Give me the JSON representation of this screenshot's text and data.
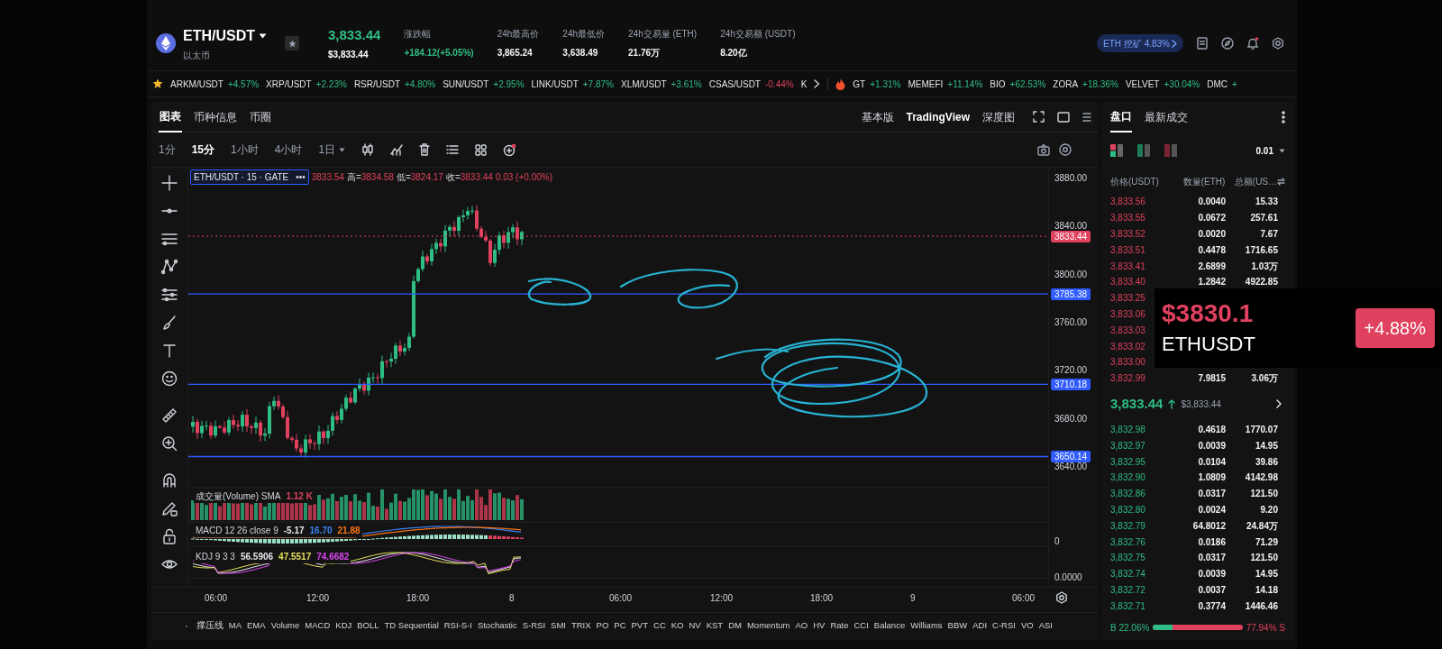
{
  "header": {
    "pair": "ETH/USDT",
    "subtitle": "以太币",
    "price": "3,833.44",
    "price_usd": "$3,833.44",
    "stats": [
      {
        "label": "涨跌幅",
        "value": "+184.12(+5.05%)",
        "kind": "up"
      },
      {
        "label": "24h最高价",
        "value": "3,865.24",
        "kind": "plain"
      },
      {
        "label": "24h最低价",
        "value": "3,638.49",
        "kind": "plain"
      },
      {
        "label": "24h交易量 (ETH)",
        "value": "21.76万",
        "kind": "plain"
      },
      {
        "label": "24h交易额 (USDT)",
        "value": "8.20亿",
        "kind": "plain"
      }
    ],
    "mining_badge": "ETH 挖矿 4.83%"
  },
  "ticker": {
    "favorites": [
      {
        "symbol": "ARKM/USDT",
        "change": "+4.57%",
        "kind": "up"
      },
      {
        "symbol": "XRP/USDT",
        "change": "+2.23%",
        "kind": "up"
      },
      {
        "symbol": "RSR/USDT",
        "change": "+4.80%",
        "kind": "up"
      },
      {
        "symbol": "SUN/USDT",
        "change": "+2.95%",
        "kind": "up"
      },
      {
        "symbol": "LINK/USDT",
        "change": "+7.87%",
        "kind": "up"
      },
      {
        "symbol": "XLM/USDT",
        "change": "+3.61%",
        "kind": "up"
      },
      {
        "symbol": "CSAS/USDT",
        "change": "-0.44%",
        "kind": "down"
      },
      {
        "symbol": "K"
      }
    ],
    "hot": [
      {
        "symbol": "GT",
        "change": "+1.31%",
        "kind": "up"
      },
      {
        "symbol": "MEMEFI",
        "change": "+11.14%",
        "kind": "up"
      },
      {
        "symbol": "BIO",
        "change": "+62.53%",
        "kind": "up"
      },
      {
        "symbol": "ZORA",
        "change": "+18.36%",
        "kind": "up"
      },
      {
        "symbol": "VELVET",
        "change": "+30.04%",
        "kind": "up"
      },
      {
        "symbol": "DMC",
        "change": "+",
        "kind": "up"
      }
    ]
  },
  "chart": {
    "tabs": [
      {
        "label": "图表",
        "selected": true
      },
      {
        "label": "币种信息",
        "selected": false
      },
      {
        "label": "币圈",
        "selected": false
      }
    ],
    "views": [
      {
        "label": "基本版",
        "selected": false
      },
      {
        "label": "TradingView",
        "selected": true
      },
      {
        "label": "深度图",
        "selected": false
      }
    ],
    "intervals": [
      {
        "label": "1分",
        "selected": false
      },
      {
        "label": "15分",
        "selected": true
      },
      {
        "label": "1小时",
        "selected": false
      },
      {
        "label": "4小时",
        "selected": false
      },
      {
        "label": "1日",
        "selected": false,
        "dropdown": true
      }
    ],
    "legend": {
      "symbol": "ETH/USDT · 15 · GATE",
      "more": "•••",
      "items": [
        {
          "value": "3833.54"
        },
        {
          "label": "高=",
          "value": "3834.58"
        },
        {
          "label": "低=",
          "value": "3824.17"
        },
        {
          "label": "收=",
          "value": "3833.44"
        },
        {
          "value": "0.03 (+0.00%)"
        }
      ]
    },
    "price_axis": [
      "3880.00",
      "3840.00",
      "3800.00",
      "3760.00",
      "3720.00",
      "3680.00",
      "3640.00"
    ],
    "price_tags": [
      {
        "value": "3833.44",
        "kind": "last"
      },
      {
        "value": "3785.38",
        "kind": "line"
      },
      {
        "value": "3710.18",
        "kind": "line"
      },
      {
        "value": "3650.14",
        "kind": "line"
      }
    ],
    "indicators": [
      {
        "label": "成交量(Volume) SMA",
        "values": [
          {
            "value": "1.12 K",
            "color": "#e0415e"
          }
        ]
      },
      {
        "label": "MACD 12 26 close 9",
        "values": [
          {
            "value": "-5.17",
            "color": "#e5e7eb"
          },
          {
            "value": "16.70",
            "color": "#3b82f6"
          },
          {
            "value": "21.88",
            "color": "#f97316"
          }
        ]
      },
      {
        "label": "KDJ 9 3 3",
        "values": [
          {
            "value": "56.5906",
            "color": "#e5e7eb"
          },
          {
            "value": "47.5517",
            "color": "#e5e05a"
          },
          {
            "value": "74.6682",
            "color": "#d946ef"
          }
        ]
      }
    ],
    "sub_axis": [
      "0",
      "0.0000"
    ],
    "time_axis": [
      "06:00",
      "12:00",
      "18:00",
      "8",
      "06:00",
      "12:00",
      "18:00",
      "9",
      "06:00"
    ],
    "indicator_bar": [
      "撑压线",
      "MA",
      "EMA",
      "Volume",
      "MACD",
      "KDJ",
      "BOLL",
      "TD Sequential",
      "RSI-S-I",
      "Stochastic",
      "S-RSI",
      "SMI",
      "TRIX",
      "PO",
      "PC",
      "PVT",
      "CC",
      "KO",
      "NV",
      "KST",
      "DM",
      "Momentum",
      "AO",
      "HV",
      "Rate",
      "CCI",
      "Balance",
      "Williams",
      "BBW",
      "ADI",
      "C-RSI",
      "VO",
      "ASI"
    ]
  },
  "order_book": {
    "tabs": [
      {
        "label": "盘口",
        "selected": true
      },
      {
        "label": "最新成交",
        "selected": false
      }
    ],
    "precision": "0.01",
    "columns": [
      "价格(USDT)",
      "数量(ETH)",
      "总额(US…"
    ],
    "asks": [
      {
        "price": "3,833.56",
        "amount": "0.0040",
        "total": "15.33"
      },
      {
        "price": "3,833.55",
        "amount": "0.0672",
        "total": "257.61"
      },
      {
        "price": "3,833.52",
        "amount": "0.0020",
        "total": "7.67"
      },
      {
        "price": "3,833.51",
        "amount": "0.4478",
        "total": "1716.65"
      },
      {
        "price": "3,833.41",
        "amount": "2.6899",
        "total": "1.03万"
      },
      {
        "price": "3,833.40",
        "amount": "1.2842",
        "total": "4922.85"
      },
      {
        "price": "3,833.25"
      },
      {
        "price": "3,833.06"
      },
      {
        "price": "3,833.03"
      },
      {
        "price": "3,833.02"
      },
      {
        "price": "3,833.00"
      },
      {
        "price": "3,832.99",
        "amount": "7.9815",
        "total": "3.06万"
      }
    ],
    "mid": {
      "price": "3,833.44",
      "usd": "$3,833.44"
    },
    "bids": [
      {
        "price": "3,832.98",
        "amount": "0.4618",
        "total": "1770.07"
      },
      {
        "price": "3,832.97",
        "amount": "0.0039",
        "total": "14.95"
      },
      {
        "price": "3,832.95",
        "amount": "0.0104",
        "total": "39.86"
      },
      {
        "price": "3,832.90",
        "amount": "1.0809",
        "total": "4142.98"
      },
      {
        "price": "3,832.86",
        "amount": "0.0317",
        "total": "121.50"
      },
      {
        "price": "3,832.80",
        "amount": "0.0024",
        "total": "9.20"
      },
      {
        "price": "3,832.79",
        "amount": "64.8012",
        "total": "24.84万"
      },
      {
        "price": "3,832.76",
        "amount": "0.0186",
        "total": "71.29"
      },
      {
        "price": "3,832.75",
        "amount": "0.0317",
        "total": "121.50"
      },
      {
        "price": "3,832.74",
        "amount": "0.0039",
        "total": "14.95"
      },
      {
        "price": "3,832.72",
        "amount": "0.0037",
        "total": "14.18"
      },
      {
        "price": "3,832.71",
        "amount": "0.3774",
        "total": "1446.46"
      }
    ],
    "ratio": {
      "buy": "B 22.06%",
      "sell": "77.94% S",
      "level": 0.2206
    }
  },
  "overlay": {
    "price": "$3830.1",
    "symbol": "ETHUSDT",
    "change": "+4.88%"
  }
}
